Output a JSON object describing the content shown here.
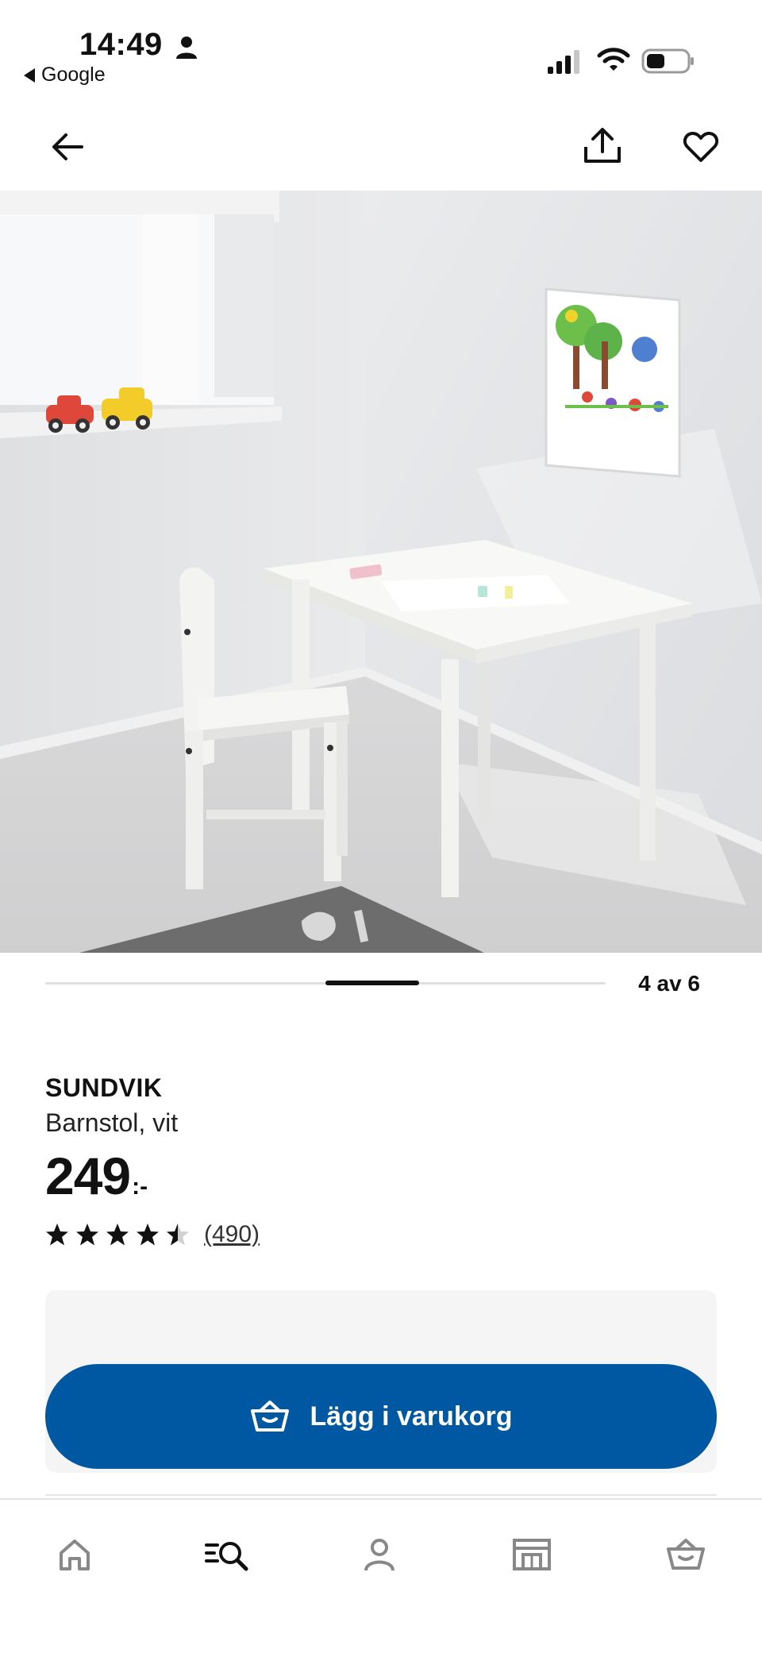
{
  "status_bar": {
    "time": "14:49",
    "back_app": "Google"
  },
  "top_nav": {
    "icons": [
      "back-arrow-icon",
      "share-icon",
      "heart-icon"
    ]
  },
  "pager": {
    "count_label": "4 av 6",
    "current": 4,
    "total": 6
  },
  "product": {
    "brand": "SUNDVIK",
    "description": "Barnstol, vit",
    "price_integer": "249",
    "price_suffix": ":-",
    "rating": 4.5,
    "review_count": "(490)"
  },
  "purchase": {
    "add_to_cart_label": "Lägg i varukorg",
    "button_color": "#0058a3"
  },
  "tab_bar": {
    "tabs": [
      "home-icon",
      "search-icon",
      "profile-icon",
      "store-icon",
      "basket-icon"
    ]
  }
}
